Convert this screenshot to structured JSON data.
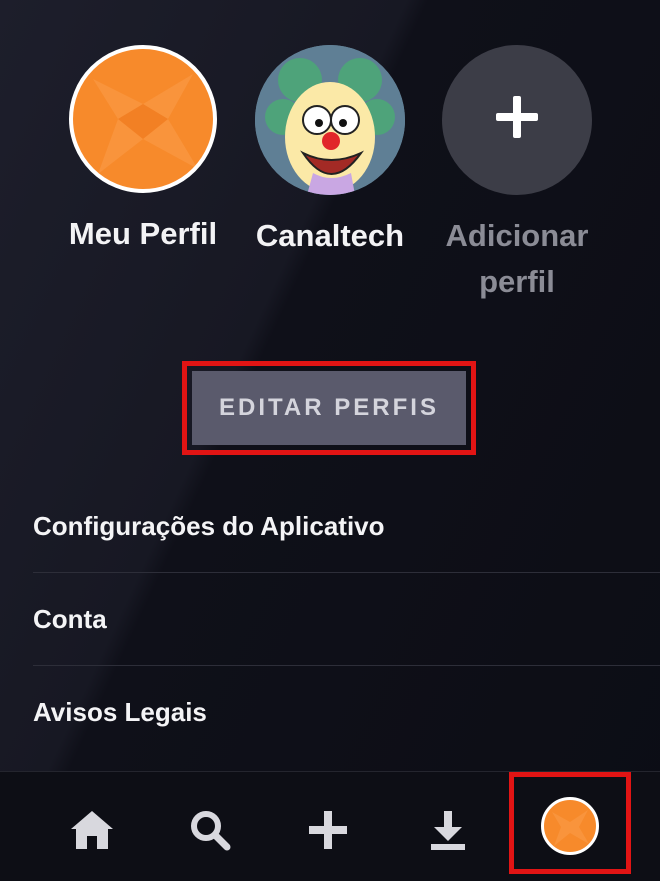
{
  "profiles": [
    {
      "name": "Meu Perfil",
      "avatar": "orange-star-avatar"
    },
    {
      "name": "Canaltech",
      "avatar": "krusty-clown-avatar"
    },
    {
      "name": "Adicionar perfil",
      "avatar": "plus-icon"
    }
  ],
  "edit_button": {
    "label": "EDITAR PERFIS"
  },
  "menu": [
    {
      "label": "Configurações do Aplicativo"
    },
    {
      "label": "Conta"
    },
    {
      "label": "Avisos Legais"
    }
  ],
  "tabbar": {
    "items": [
      "home-icon",
      "search-icon",
      "plus-icon",
      "download-icon",
      "profile-avatar"
    ]
  },
  "colors": {
    "highlight": "#e11414",
    "avatar_orange": "#f78a2b",
    "button_bg": "#5a5a6c",
    "background": "#13141e"
  }
}
